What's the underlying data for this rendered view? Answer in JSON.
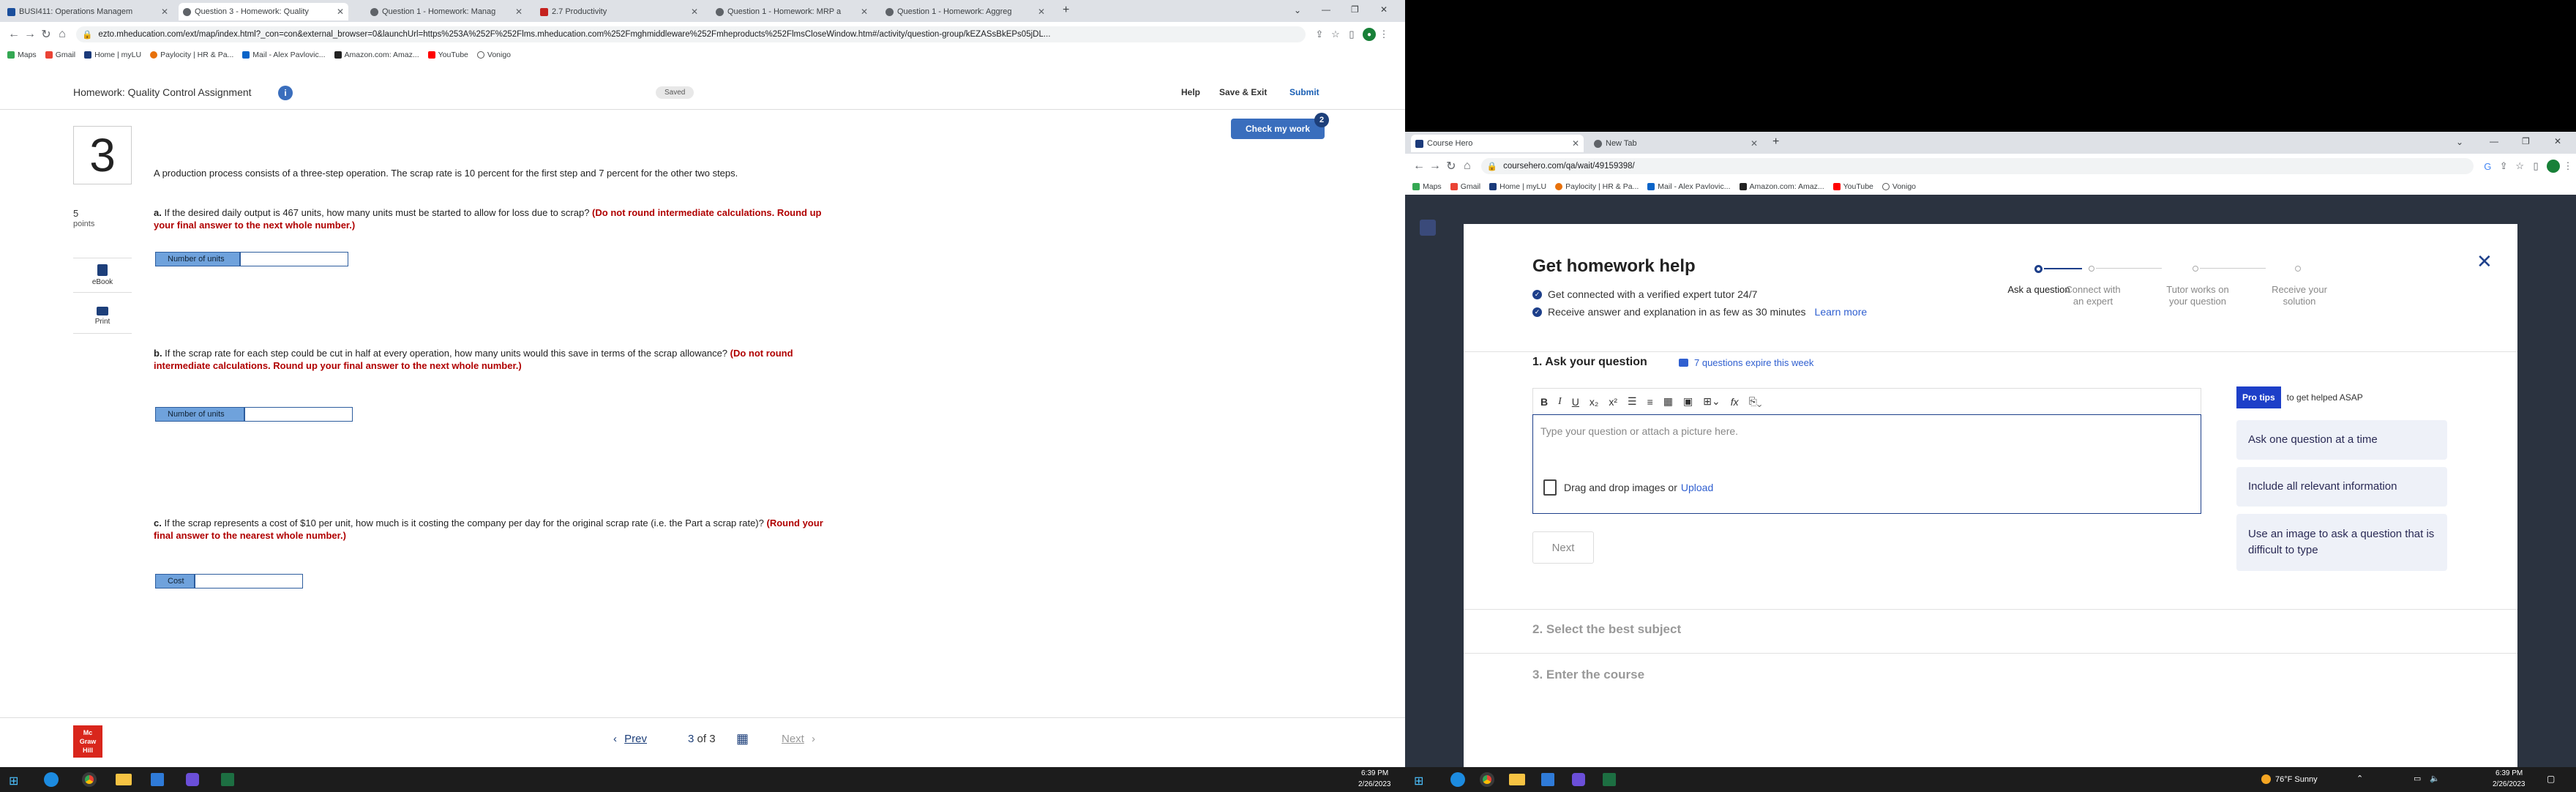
{
  "left_window": {
    "tabs": [
      {
        "title": "BUSI411: Operations Managem",
        "color": "#1b4f9c",
        "active": false
      },
      {
        "title": "Question 3 - Homework: Quality",
        "color": "#5f6368",
        "active": true
      },
      {
        "title": "Question 1 - Homework: Manag",
        "color": "#5f6368",
        "active": false
      },
      {
        "title": "2.7 Productivity",
        "color": "#c5221f",
        "active": false
      },
      {
        "title": "Question 1 - Homework: MRP a",
        "color": "#5f6368",
        "active": false
      },
      {
        "title": "Question 1 - Homework: Aggreg",
        "color": "#5f6368",
        "active": false
      }
    ],
    "new_tab": "+",
    "url": "ezto.mheducation.com/ext/map/index.html?_con=con&external_browser=0&launchUrl=https%253A%252F%252Flms.mheducation.com%252Fmghmiddleware%252Fmheproducts%252FlmsCloseWindow.htm#/activity/question-group/kEZASsBkEPs05jDL...",
    "bookmarks": [
      {
        "label": "Maps",
        "color": "#34a853"
      },
      {
        "label": "Gmail",
        "color": "#ea4335"
      },
      {
        "label": "Home | myLU",
        "color": "#1a3a7a"
      },
      {
        "label": "Paylocity | HR & Pa...",
        "color": "#e8710a"
      },
      {
        "label": "Mail - Alex Pavlovic...",
        "color": "#0a64c8"
      },
      {
        "label": "Amazon.com: Amaz...",
        "color": "#222222"
      },
      {
        "label": "YouTube",
        "color": "#ff0000"
      },
      {
        "label": "Vonigo",
        "color": "#555555"
      }
    ],
    "header": {
      "title": "Homework: Quality Control Assignment",
      "saved": "Saved",
      "help": "Help",
      "save_exit": "Save & Exit",
      "submit": "Submit",
      "check_my_work": "Check my work",
      "check_badge": "2"
    },
    "question": {
      "number": "3",
      "points_value": "5",
      "points_label": "points",
      "ebook": "eBook",
      "print": "Print",
      "intro": "A production process consists of a three-step operation. The scrap rate is 10 percent for the first step and 7 percent for the other two steps.",
      "a_prefix": "a.",
      "a_text": " If the desired daily output is 467 units, how many units must be started to allow for loss due to scrap? ",
      "a_note": "(Do not round intermediate calculations. Round up your final answer to the next whole number.)",
      "a_field_label": "Number of units",
      "b_prefix": "b.",
      "b_text": " If the scrap rate for each step could be cut in half at every operation, how many units would this save in terms of the scrap allowance? ",
      "b_note": "(Do not round intermediate calculations. Round up your final answer to the next whole number.)",
      "b_field_label": "Number of units",
      "c_prefix": "c.",
      "c_text": " If the scrap represents a cost of $10 per unit, how much is it costing the company per day for the original scrap rate (i.e. the Part a scrap rate)? ",
      "c_note": "(Round your final answer to the nearest whole number.)",
      "c_field_label": "Cost"
    },
    "footer": {
      "logo_lines": [
        "Mc",
        "Graw",
        "Hill"
      ],
      "prev": "Prev",
      "current": "3",
      "of": "of",
      "total": "3",
      "next": "Next"
    },
    "taskbar_time": "6:39 PM",
    "taskbar_date": "2/26/2023"
  },
  "right_window": {
    "tabs": [
      {
        "title": "Course Hero",
        "color": "#1b3a7a",
        "active": true
      },
      {
        "title": "New Tab",
        "color": "#5f6368",
        "active": false
      }
    ],
    "url": "coursehero.com/qa/wait/49159398/",
    "bookmarks": [
      {
        "label": "Maps",
        "color": "#34a853"
      },
      {
        "label": "Gmail",
        "color": "#ea4335"
      },
      {
        "label": "Home | myLU",
        "color": "#1a3a7a"
      },
      {
        "label": "Paylocity | HR & Pa...",
        "color": "#e8710a"
      },
      {
        "label": "Mail - Alex Pavlovic...",
        "color": "#0a64c8"
      },
      {
        "label": "Amazon.com: Amaz...",
        "color": "#222222"
      },
      {
        "label": "YouTube",
        "color": "#ff0000"
      },
      {
        "label": "Vonigo",
        "color": "#555555"
      }
    ],
    "modal": {
      "title": "Get homework help",
      "bullet1": "Get connected with a verified expert tutor 24/7",
      "bullet2": "Receive answer and explanation in as few as 30 minutes",
      "learn_more": "Learn more",
      "steps": [
        {
          "label": "Ask a question",
          "active": true
        },
        {
          "label": "Connect with an expert",
          "active": false
        },
        {
          "label": "Tutor works on your question",
          "active": false
        },
        {
          "label": "Receive your solution",
          "active": false
        }
      ],
      "section1": "1. Ask your question",
      "expire_note": "7 questions expire this week",
      "editor_placeholder": "Type your question or attach a picture here.",
      "drag_text": "Drag and drop images or",
      "upload": "Upload",
      "next": "Next",
      "pro_tips": "Pro tips",
      "pro_tips_suffix": "to get helped ASAP",
      "tips": [
        "Ask one question at a time",
        "Include all relevant information",
        "Use an image to ask a question that is difficult to type"
      ],
      "section2": "2. Select the best subject",
      "section3": "3. Enter the course"
    },
    "weather": "76°F  Sunny",
    "taskbar_time": "6:39 PM",
    "taskbar_date": "2/26/2023"
  }
}
